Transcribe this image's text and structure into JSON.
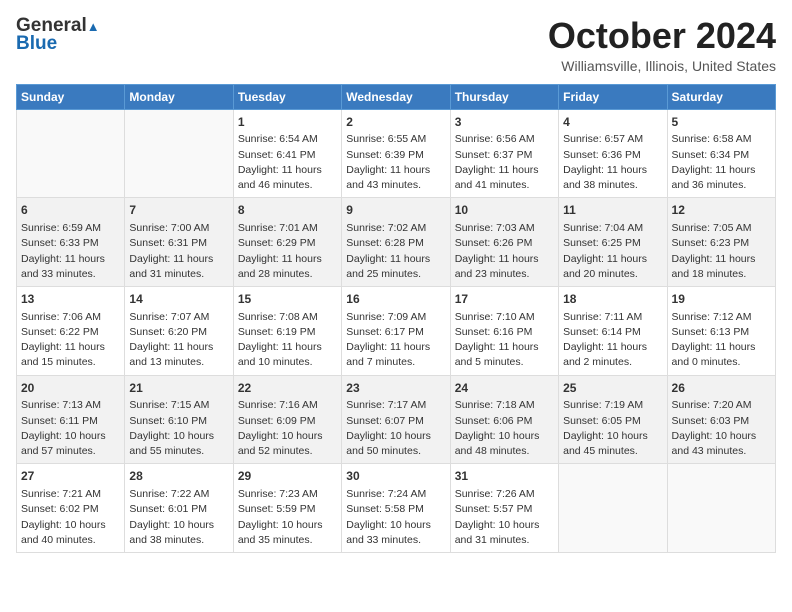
{
  "header": {
    "logo_line1": "General",
    "logo_line2": "Blue",
    "month": "October 2024",
    "location": "Williamsville, Illinois, United States"
  },
  "weekdays": [
    "Sunday",
    "Monday",
    "Tuesday",
    "Wednesday",
    "Thursday",
    "Friday",
    "Saturday"
  ],
  "weeks": [
    [
      {
        "day": "",
        "info": ""
      },
      {
        "day": "",
        "info": ""
      },
      {
        "day": "1",
        "info": "Sunrise: 6:54 AM\nSunset: 6:41 PM\nDaylight: 11 hours and 46 minutes."
      },
      {
        "day": "2",
        "info": "Sunrise: 6:55 AM\nSunset: 6:39 PM\nDaylight: 11 hours and 43 minutes."
      },
      {
        "day": "3",
        "info": "Sunrise: 6:56 AM\nSunset: 6:37 PM\nDaylight: 11 hours and 41 minutes."
      },
      {
        "day": "4",
        "info": "Sunrise: 6:57 AM\nSunset: 6:36 PM\nDaylight: 11 hours and 38 minutes."
      },
      {
        "day": "5",
        "info": "Sunrise: 6:58 AM\nSunset: 6:34 PM\nDaylight: 11 hours and 36 minutes."
      }
    ],
    [
      {
        "day": "6",
        "info": "Sunrise: 6:59 AM\nSunset: 6:33 PM\nDaylight: 11 hours and 33 minutes."
      },
      {
        "day": "7",
        "info": "Sunrise: 7:00 AM\nSunset: 6:31 PM\nDaylight: 11 hours and 31 minutes."
      },
      {
        "day": "8",
        "info": "Sunrise: 7:01 AM\nSunset: 6:29 PM\nDaylight: 11 hours and 28 minutes."
      },
      {
        "day": "9",
        "info": "Sunrise: 7:02 AM\nSunset: 6:28 PM\nDaylight: 11 hours and 25 minutes."
      },
      {
        "day": "10",
        "info": "Sunrise: 7:03 AM\nSunset: 6:26 PM\nDaylight: 11 hours and 23 minutes."
      },
      {
        "day": "11",
        "info": "Sunrise: 7:04 AM\nSunset: 6:25 PM\nDaylight: 11 hours and 20 minutes."
      },
      {
        "day": "12",
        "info": "Sunrise: 7:05 AM\nSunset: 6:23 PM\nDaylight: 11 hours and 18 minutes."
      }
    ],
    [
      {
        "day": "13",
        "info": "Sunrise: 7:06 AM\nSunset: 6:22 PM\nDaylight: 11 hours and 15 minutes."
      },
      {
        "day": "14",
        "info": "Sunrise: 7:07 AM\nSunset: 6:20 PM\nDaylight: 11 hours and 13 minutes."
      },
      {
        "day": "15",
        "info": "Sunrise: 7:08 AM\nSunset: 6:19 PM\nDaylight: 11 hours and 10 minutes."
      },
      {
        "day": "16",
        "info": "Sunrise: 7:09 AM\nSunset: 6:17 PM\nDaylight: 11 hours and 7 minutes."
      },
      {
        "day": "17",
        "info": "Sunrise: 7:10 AM\nSunset: 6:16 PM\nDaylight: 11 hours and 5 minutes."
      },
      {
        "day": "18",
        "info": "Sunrise: 7:11 AM\nSunset: 6:14 PM\nDaylight: 11 hours and 2 minutes."
      },
      {
        "day": "19",
        "info": "Sunrise: 7:12 AM\nSunset: 6:13 PM\nDaylight: 11 hours and 0 minutes."
      }
    ],
    [
      {
        "day": "20",
        "info": "Sunrise: 7:13 AM\nSunset: 6:11 PM\nDaylight: 10 hours and 57 minutes."
      },
      {
        "day": "21",
        "info": "Sunrise: 7:15 AM\nSunset: 6:10 PM\nDaylight: 10 hours and 55 minutes."
      },
      {
        "day": "22",
        "info": "Sunrise: 7:16 AM\nSunset: 6:09 PM\nDaylight: 10 hours and 52 minutes."
      },
      {
        "day": "23",
        "info": "Sunrise: 7:17 AM\nSunset: 6:07 PM\nDaylight: 10 hours and 50 minutes."
      },
      {
        "day": "24",
        "info": "Sunrise: 7:18 AM\nSunset: 6:06 PM\nDaylight: 10 hours and 48 minutes."
      },
      {
        "day": "25",
        "info": "Sunrise: 7:19 AM\nSunset: 6:05 PM\nDaylight: 10 hours and 45 minutes."
      },
      {
        "day": "26",
        "info": "Sunrise: 7:20 AM\nSunset: 6:03 PM\nDaylight: 10 hours and 43 minutes."
      }
    ],
    [
      {
        "day": "27",
        "info": "Sunrise: 7:21 AM\nSunset: 6:02 PM\nDaylight: 10 hours and 40 minutes."
      },
      {
        "day": "28",
        "info": "Sunrise: 7:22 AM\nSunset: 6:01 PM\nDaylight: 10 hours and 38 minutes."
      },
      {
        "day": "29",
        "info": "Sunrise: 7:23 AM\nSunset: 5:59 PM\nDaylight: 10 hours and 35 minutes."
      },
      {
        "day": "30",
        "info": "Sunrise: 7:24 AM\nSunset: 5:58 PM\nDaylight: 10 hours and 33 minutes."
      },
      {
        "day": "31",
        "info": "Sunrise: 7:26 AM\nSunset: 5:57 PM\nDaylight: 10 hours and 31 minutes."
      },
      {
        "day": "",
        "info": ""
      },
      {
        "day": "",
        "info": ""
      }
    ]
  ]
}
